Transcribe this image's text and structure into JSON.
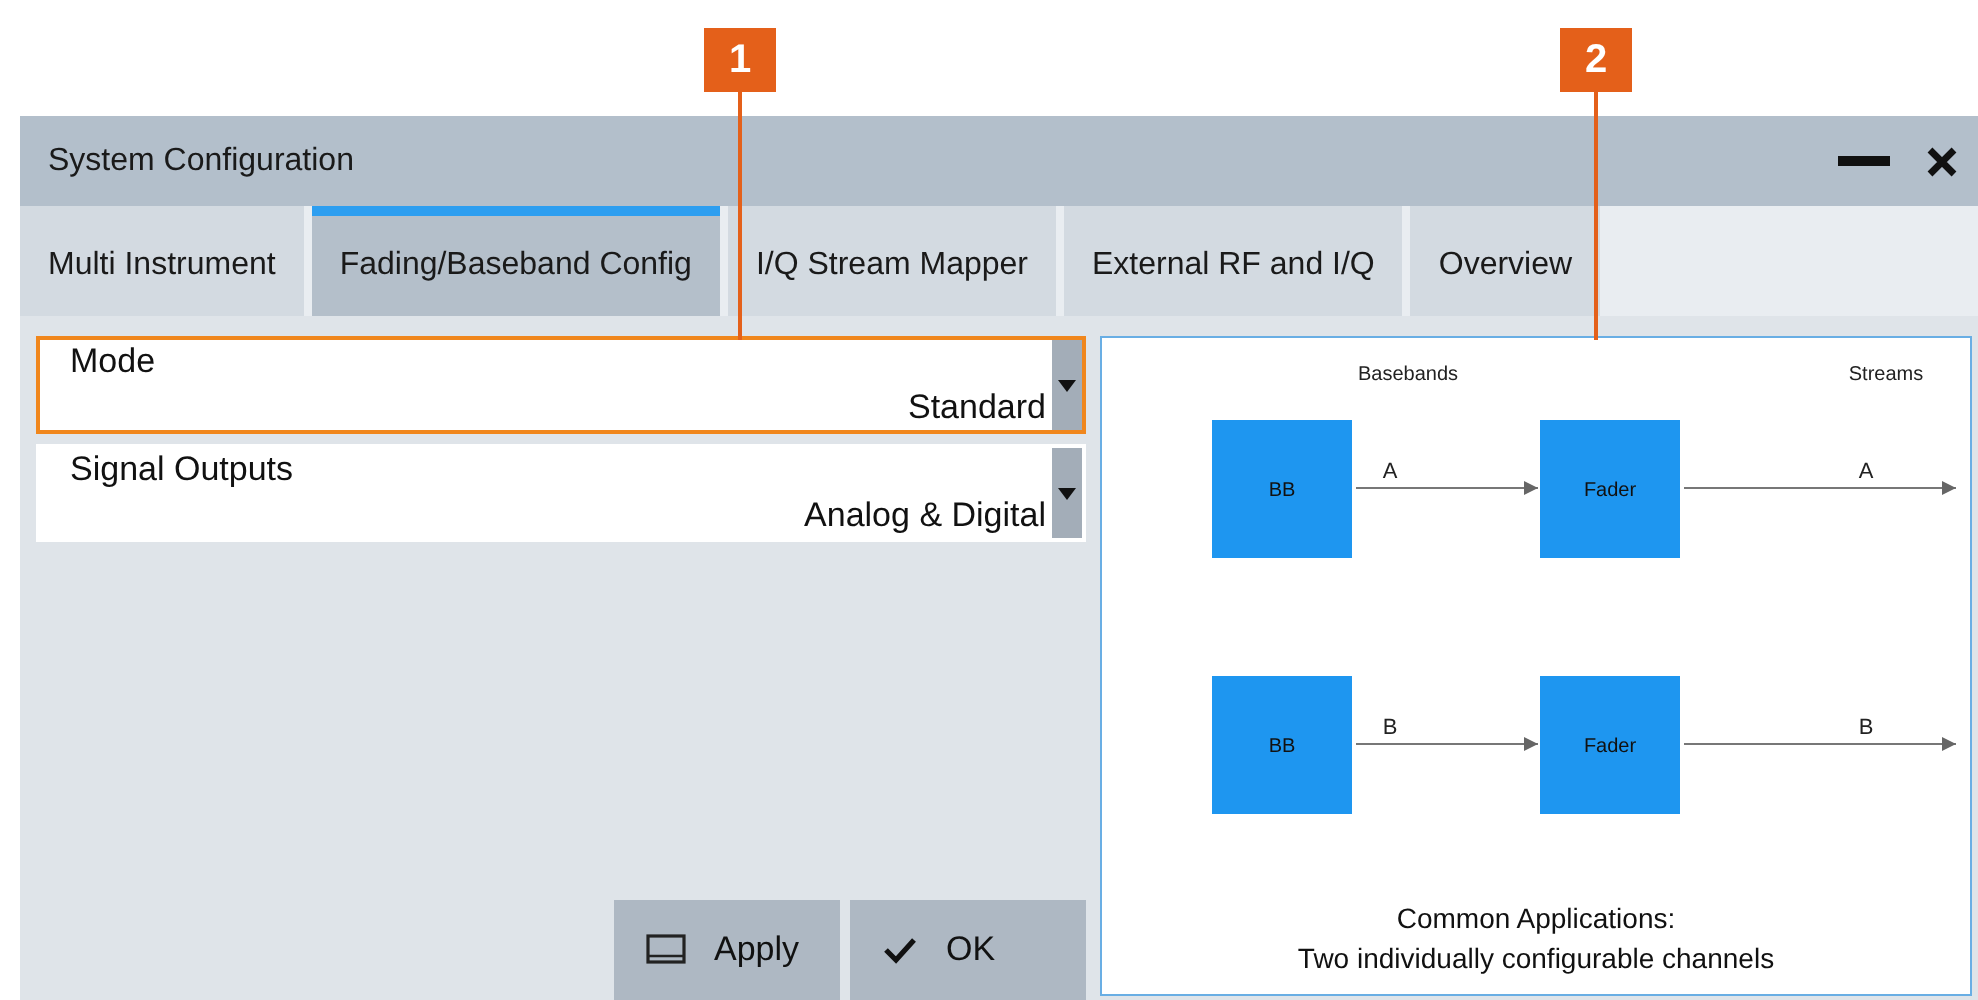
{
  "callouts": [
    {
      "label": "1"
    },
    {
      "label": "2"
    }
  ],
  "window": {
    "title": "System Configuration"
  },
  "tabs": [
    {
      "label": "Multi Instrument",
      "selected": false
    },
    {
      "label": "Fading/Baseband Config",
      "selected": true
    },
    {
      "label": "I/Q Stream Mapper",
      "selected": false
    },
    {
      "label": "External RF and I/Q",
      "selected": false
    },
    {
      "label": "Overview",
      "selected": false
    }
  ],
  "fields": [
    {
      "label": "Mode",
      "value": "Standard",
      "highlighted": true
    },
    {
      "label": "Signal Outputs",
      "value": "Analog & Digital",
      "highlighted": false
    }
  ],
  "buttons": [
    {
      "label": "Apply",
      "kind": "apply"
    },
    {
      "label": "OK",
      "kind": "ok"
    }
  ],
  "diagram": {
    "headers": [
      "Basebands",
      "Streams"
    ],
    "rows": [
      {
        "source": "BB",
        "link": "A",
        "fader": "Fader",
        "stream": "A"
      },
      {
        "source": "BB",
        "link": "B",
        "fader": "Fader",
        "stream": "B"
      }
    ],
    "caption": [
      "Common Applications:",
      "Two individually configurable channels"
    ]
  }
}
